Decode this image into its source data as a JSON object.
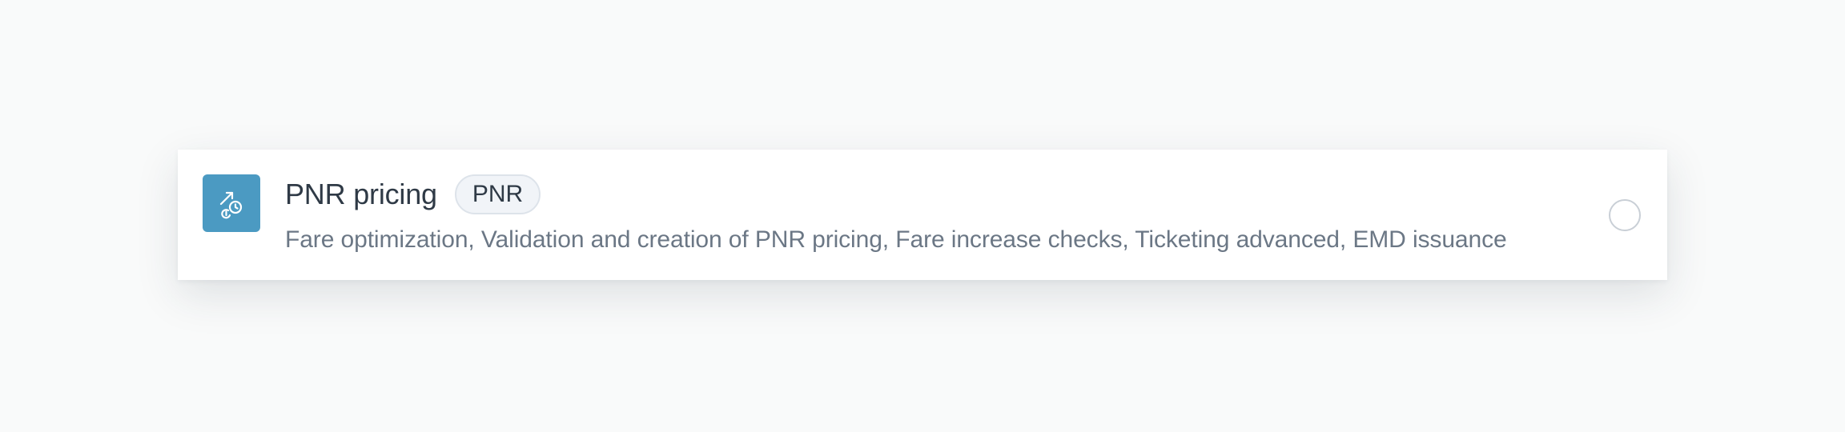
{
  "option": {
    "icon": "pricing-trend-clock-icon",
    "title": "PNR pricing",
    "badge": "PNR",
    "description": "Fare optimization, Validation and creation of PNR pricing, Fare increase checks, Ticketing advanced, EMD issuance",
    "selected": false
  },
  "colors": {
    "background": "#f9fafa",
    "card": "#ffffff",
    "icon_tile": "#4b9ac2",
    "title": "#2f3a46",
    "description": "#6b7785",
    "badge_border": "#dde3ea",
    "radio_border": "#c9cfd6"
  }
}
